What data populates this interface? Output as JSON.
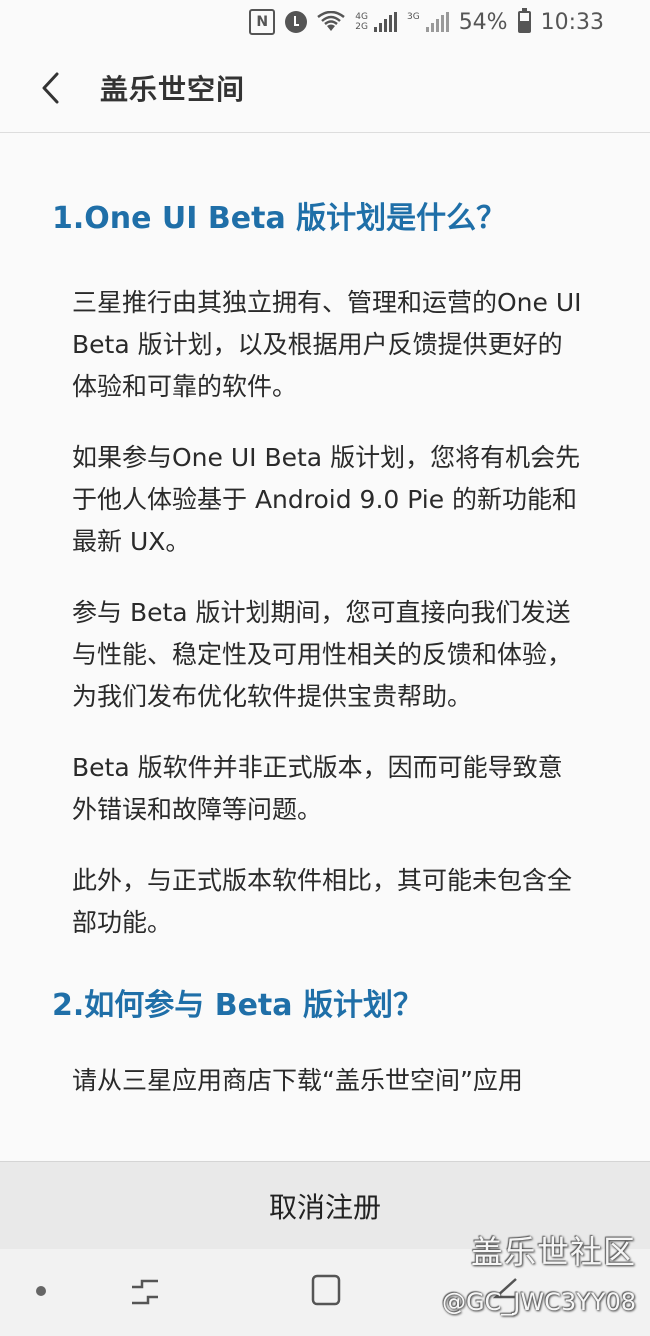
{
  "status_bar": {
    "battery": "54%",
    "time": "10:33",
    "net_top": "4G",
    "net_bottom": "2G",
    "net_secondary": "3G",
    "icons": [
      "nfc-icon",
      "alarm-icon",
      "wifi-icon",
      "signal-icon",
      "battery-icon"
    ]
  },
  "app_bar": {
    "title": "盖乐世空间",
    "back_icon": "chevron-left-icon"
  },
  "content": {
    "heading1": "1.One UI Beta 版计划是什么？",
    "paragraphs": [
      "三星推行由其独立拥有、管理和运营的One UI Beta 版计划，以及根据用户反馈提供更好的体验和可靠的软件。",
      "如果参与One UI Beta 版计划，您将有机会先于他人体验基于 Android 9.0 Pie 的新功能和最新 UX。",
      "参与 Beta 版计划期间，您可直接向我们发送与性能、稳定性及可用性相关的反馈和体验，为我们发布优化软件提供宝贵帮助。",
      "Beta 版软件并非正式版本，因而可能导致意外错误和故障等问题。",
      "此外，与正式版本软件相比，其可能未包含全部功能。"
    ],
    "heading2": "2.如何参与 Beta 版计划？",
    "cut_paragraph": "请从三星应用商店下载“盖乐世空间”应用"
  },
  "bottom_button": {
    "label": "取消注册"
  },
  "nav_bar": {
    "icons": [
      "dot-icon",
      "recent-apps-icon",
      "home-icon",
      "back-icon"
    ]
  },
  "watermark": {
    "title": "盖乐世社区",
    "user": "@GC_JWC3YY08"
  },
  "colors": {
    "heading": "#1f6fa8",
    "background": "#fafafa",
    "bottom_bar": "#e9e9e9"
  }
}
